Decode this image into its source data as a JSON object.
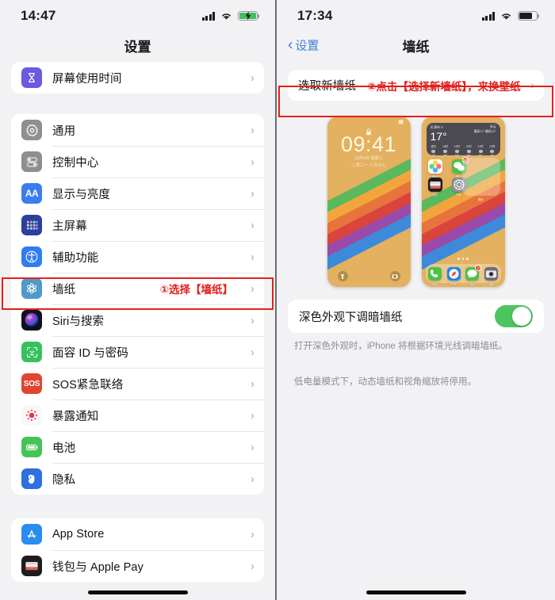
{
  "left": {
    "status": {
      "time": "14:47",
      "signal_icon": "signal-bars-icon",
      "wifi_icon": "wifi-icon",
      "battery_icon": "battery-charging-icon"
    },
    "nav": {
      "title": "设置"
    },
    "group1": [
      {
        "label": "屏幕使用时间",
        "icon": "hourglass-icon",
        "color": "#6a5ae0"
      }
    ],
    "group2": [
      {
        "label": "通用",
        "icon": "gear-icon",
        "color": "#8e8e93"
      },
      {
        "label": "控制中心",
        "icon": "control-center-icon",
        "color": "#8e8e93"
      },
      {
        "label": "显示与亮度",
        "icon": "display-brightness-icon",
        "color": "#3b7df0"
      },
      {
        "label": "主屏幕",
        "icon": "home-screen-grid-icon",
        "color": "#2b3f9e"
      },
      {
        "label": "辅助功能",
        "icon": "accessibility-icon",
        "color": "#2f7cf6"
      },
      {
        "label": "墙纸",
        "icon": "wallpaper-flower-icon",
        "color": "#4e9ac9",
        "annotation": "①选择【墙纸】"
      },
      {
        "label": "Siri与搜索",
        "icon": "siri-icon",
        "color": "#2b1b3a"
      },
      {
        "label": "面容 ID 与密码",
        "icon": "face-id-icon",
        "color": "#37c15c"
      },
      {
        "label": "SOS紧急联络",
        "icon": "sos-icon",
        "color": "#e0452f"
      },
      {
        "label": "暴露通知",
        "icon": "exposure-notification-icon",
        "color": "#f4f2f3"
      },
      {
        "label": "电池",
        "icon": "battery-icon",
        "color": "#45c357"
      },
      {
        "label": "隐私",
        "icon": "privacy-hand-icon",
        "color": "#2f6fe0"
      }
    ],
    "group3": [
      {
        "label": "App Store",
        "icon": "app-store-icon",
        "color": "#2a8cf0"
      },
      {
        "label": "钱包与 Apple Pay",
        "icon": "wallet-icon",
        "color": "#1d1d1f"
      }
    ],
    "chevron": "›"
  },
  "right": {
    "status": {
      "time": "17:34",
      "signal_icon": "signal-bars-icon",
      "wifi_icon": "wifi-icon",
      "battery_icon": "battery-icon"
    },
    "nav": {
      "back_label": "设置",
      "back_icon": "chevron-left-icon",
      "title": "墙纸"
    },
    "choose_row": {
      "label": "选取新墙纸",
      "annotation": "②点击【选择新墙纸】，来换壁纸",
      "chevron": "›"
    },
    "lock_preview": {
      "time": "09:41",
      "date": "10月5日 星期二",
      "subdate": "二零二一 八月廿九",
      "lock_icon": "lock-icon",
      "flashlight_icon": "flashlight-icon",
      "camera_icon": "camera-icon",
      "bg_color": "#e3b160"
    },
    "home_preview": {
      "widget": {
        "city": "天津市 4",
        "temp": "17°",
        "high_low": "最高17° 最低13°",
        "cond": "多云",
        "hours": [
          "现在",
          "18时",
          "19时",
          "20时",
          "21时",
          "22时"
        ],
        "temps": [
          "17°",
          "16°",
          "15°",
          "15°",
          "14°",
          "14°"
        ]
      },
      "apps": [
        {
          "name": "照片",
          "icon": "photos-icon"
        },
        {
          "name": "微信",
          "icon": "wechat-icon",
          "badge": "20"
        },
        {
          "name": "钱包",
          "icon": "wallet-icon"
        },
        {
          "name": "设置",
          "icon": "settings-icon"
        }
      ],
      "big_widget_label": "照片",
      "dock": [
        {
          "name": "电话",
          "icon": "phone-icon"
        },
        {
          "name": "Safari",
          "icon": "safari-icon"
        },
        {
          "name": "信息",
          "icon": "messages-icon",
          "badge": "3"
        },
        {
          "name": "相机",
          "icon": "camera-icon"
        }
      ]
    },
    "dark_toggle": {
      "label": "深色外观下调暗墙纸",
      "state": "on"
    },
    "footnote1": "打开深色外观时，iPhone 将根据环境光线调暗墙纸。",
    "footnote2": "低电量模式下，动态墙纸和视角缩放将停用。"
  },
  "colors": {
    "highlight": "#e32119",
    "accent_blue": "#3f7fd6",
    "toggle_green": "#4cc45f"
  }
}
